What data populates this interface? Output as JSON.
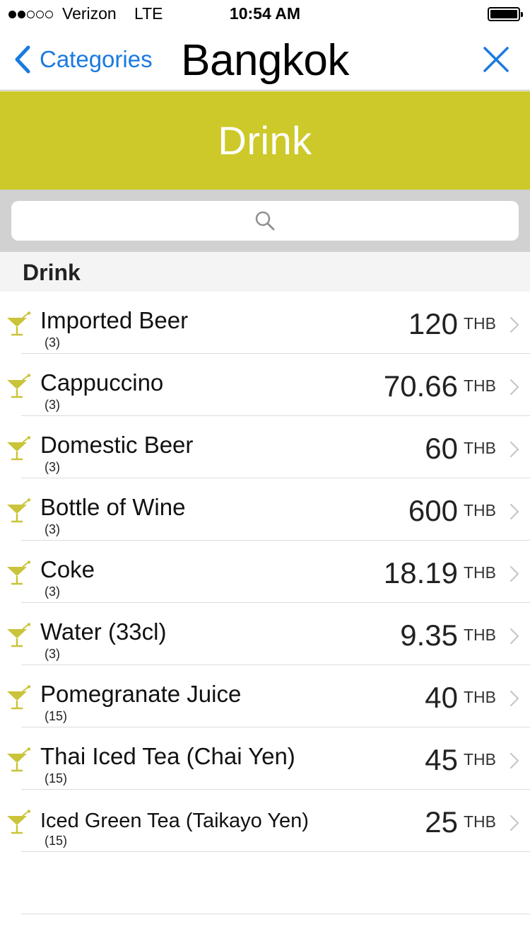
{
  "status_bar": {
    "carrier": "Verizon",
    "network": "LTE",
    "time": "10:54 AM",
    "signal_bars_filled": 2,
    "signal_bars_total": 5
  },
  "nav": {
    "back_label": "Categories",
    "title": "Bangkok",
    "back_icon": "chevron-left-icon",
    "close_icon": "close-icon"
  },
  "category": {
    "title": "Drink",
    "color": "#cdc92a"
  },
  "search": {
    "placeholder": "",
    "icon": "search-icon"
  },
  "section": {
    "title": "Drink"
  },
  "items": [
    {
      "name": "Imported Beer",
      "count": "(3)",
      "price": "120",
      "currency": "THB",
      "icon": "cocktail-glass-icon"
    },
    {
      "name": "Cappuccino",
      "count": "(3)",
      "price": "70.66",
      "currency": "THB",
      "icon": "cocktail-glass-icon"
    },
    {
      "name": "Domestic Beer",
      "count": "(3)",
      "price": "60",
      "currency": "THB",
      "icon": "cocktail-glass-icon"
    },
    {
      "name": "Bottle of Wine",
      "count": "(3)",
      "price": "600",
      "currency": "THB",
      "icon": "cocktail-glass-icon"
    },
    {
      "name": "Coke",
      "count": "(3)",
      "price": "18.19",
      "currency": "THB",
      "icon": "cocktail-glass-icon"
    },
    {
      "name": "Water (33cl)",
      "count": "(3)",
      "price": "9.35",
      "currency": "THB",
      "icon": "cocktail-glass-icon"
    },
    {
      "name": "Pomegranate Juice",
      "count": "(15)",
      "price": "40",
      "currency": "THB",
      "icon": "cocktail-glass-icon"
    },
    {
      "name": "Thai Iced Tea (Chai Yen)",
      "count": "(15)",
      "price": "45",
      "currency": "THB",
      "icon": "cocktail-glass-icon"
    },
    {
      "name": "Iced Green Tea (Taikayo Yen)",
      "count": "(15)",
      "price": "25",
      "currency": "THB",
      "icon": "cocktail-glass-icon"
    }
  ],
  "colors": {
    "accent_blue": "#1a7ae0",
    "category_banner": "#cdc92a",
    "icon_yellow": "#c9c43a"
  }
}
